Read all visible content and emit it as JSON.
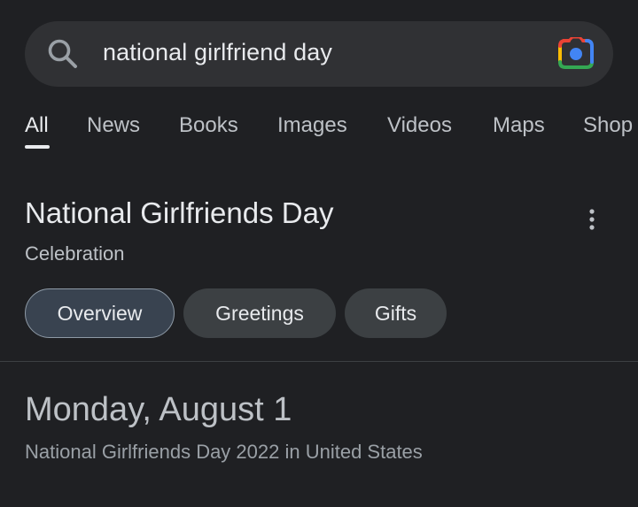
{
  "search": {
    "query": "national girlfriend day"
  },
  "tabs": [
    {
      "label": "All",
      "active": true
    },
    {
      "label": "News"
    },
    {
      "label": "Books"
    },
    {
      "label": "Images"
    },
    {
      "label": "Videos"
    },
    {
      "label": "Maps"
    },
    {
      "label": "Shop"
    }
  ],
  "knowledge_panel": {
    "title": "National Girlfriends Day",
    "subtitle": "Celebration",
    "chips": [
      {
        "label": "Overview",
        "selected": true
      },
      {
        "label": "Greetings"
      },
      {
        "label": "Gifts"
      }
    ],
    "date_heading": "Monday, August 1",
    "date_detail": "National Girlfriends Day 2022 in United States"
  },
  "icons": {
    "search": "search-icon",
    "lens": "google-lens-icon",
    "more": "more-vert-icon"
  },
  "colors": {
    "background": "#1f2023",
    "search_bar": "#303134",
    "chip": "#3c4043",
    "chip_selected": "#394350"
  }
}
